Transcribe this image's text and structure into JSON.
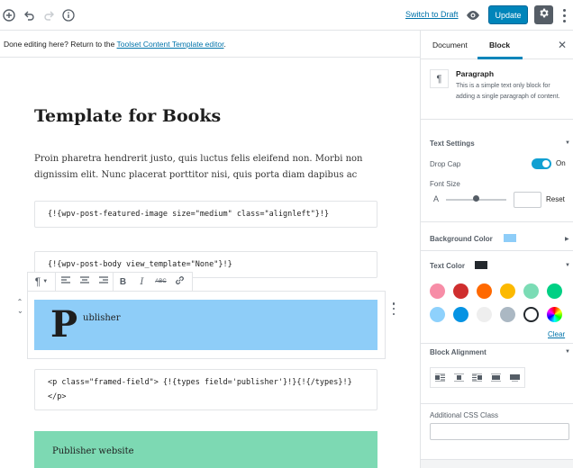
{
  "topbar": {
    "add_icon": "plus-circle-icon",
    "undo_icon": "undo-icon",
    "redo_icon": "redo-icon",
    "info_icon": "info-icon",
    "switch_to_draft": "Switch to Draft",
    "preview_icon": "eye-icon",
    "update_label": "Update",
    "settings_icon": "gear-icon",
    "more_icon": "vertical-ellipsis-icon"
  },
  "notice": {
    "text": "Done editing here? Return to the ",
    "link": "Toolset Content Template editor",
    "suffix": "."
  },
  "editor": {
    "title": "Template for Books",
    "intro": "Proin pharetra hendrerit justo, quis luctus felis eleifend non. Morbi non dignissim elit. Nunc placerat porttitor nisi, quis porta diam dapibus ac",
    "featured_image_code": "{!{wpv-post-featured-image size=\"medium\" class=\"alignleft\"}!}",
    "post_body_code": "{!{wpv-post-body view_template=\"None\"}!}",
    "publisher_dropcap": "P",
    "publisher_rest": "ublisher",
    "framed_field_code": "<p class=\"framed-field\"> {!{types field='publisher'}!}{!{/types}!}\n</p>",
    "website_label": "Publisher website"
  },
  "block_toolbar": {
    "paragraph_icon": "pilcrow-icon",
    "chevron_icon": "chevron-down-icon",
    "align_left_icon": "align-left-icon",
    "align_center_icon": "align-center-icon",
    "align_right_icon": "align-right-icon",
    "bold_label": "B",
    "italic_label": "I",
    "strike_label": "ABC",
    "link_icon": "link-icon"
  },
  "sidebar": {
    "tab_document": "Document",
    "tab_block": "Block",
    "close_icon": "close-icon",
    "block_name": "Paragraph",
    "block_description": "This is a simple text only block for adding a single paragraph of content.",
    "text_settings": "Text Settings",
    "drop_cap": "Drop Cap",
    "drop_cap_state": "On",
    "font_size": "Font Size",
    "font_size_glyph": "A",
    "font_size_value": "",
    "reset": "Reset",
    "background_color": "Background Color",
    "text_color": "Text Color",
    "clear": "Clear",
    "block_alignment": "Block Alignment",
    "additional_css_class": "Additional CSS Class",
    "css_class_value": ""
  },
  "colors": {
    "accent": "#0085ba",
    "link": "#0073aa",
    "publisher_bg": "#8ecdf8",
    "website_bg": "#7dd9b3",
    "text_color": "#23282d",
    "palette": [
      "#f78da7",
      "#cf2e2e",
      "#ff6900",
      "#fcb900",
      "#7bdcb5",
      "#00d084",
      "#8ed1fc",
      "#0693e3",
      "#eeeeee",
      "#abb8c3",
      "#ffffff",
      "gradient"
    ]
  }
}
